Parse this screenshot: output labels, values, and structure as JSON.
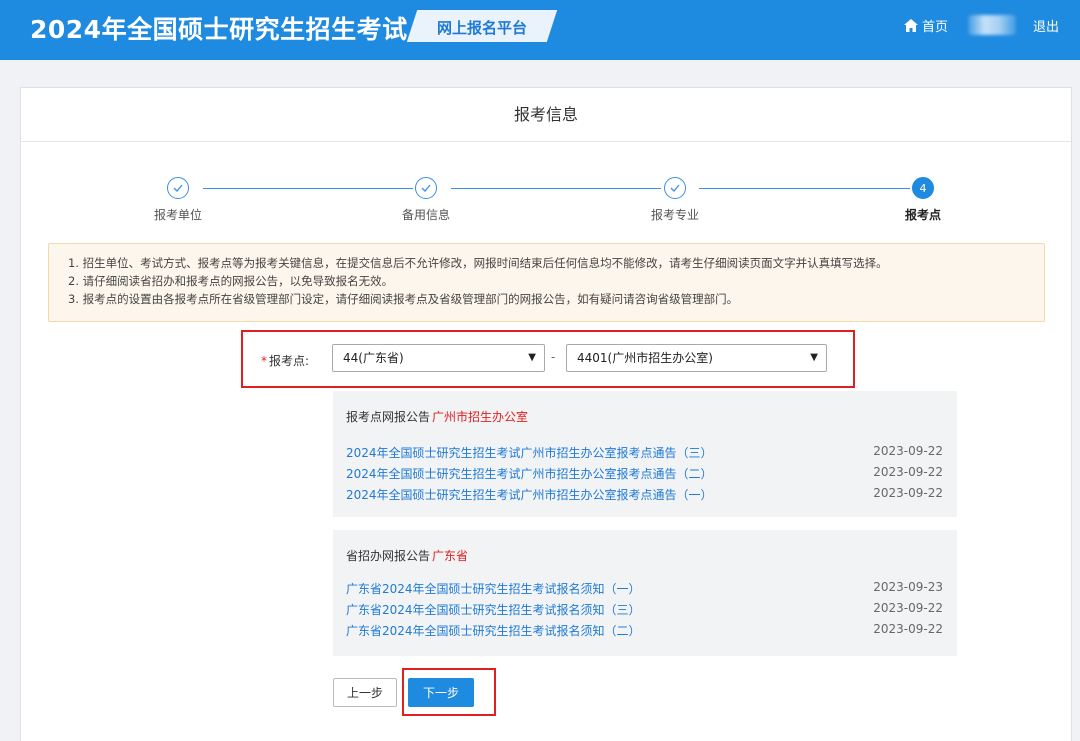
{
  "header": {
    "title": "2024年全国硕士研究生招生考试",
    "platform": "网上报名平台",
    "home": "首页",
    "logout": "退出"
  },
  "panel": {
    "title": "报考信息"
  },
  "steps": [
    {
      "label": "报考单位",
      "status": "done",
      "number": ""
    },
    {
      "label": "备用信息",
      "status": "done",
      "number": ""
    },
    {
      "label": "报考专业",
      "status": "done",
      "number": ""
    },
    {
      "label": "报考点",
      "status": "active",
      "number": "4"
    }
  ],
  "notice": [
    "1. 招生单位、考试方式、报考点等为报考关键信息，在提交信息后不允许修改，网报时间结束后任何信息均不能修改，请考生仔细阅读页面文字并认真填写选择。",
    "2. 请仔细阅读省招办和报考点的网报公告，以免导致报名无效。",
    "3. 报考点的设置由各报考点所在省级管理部门设定，请仔细阅读报考点及省级管理部门的网报公告，如有疑问请咨询省级管理部门。"
  ],
  "form": {
    "required_mark": "*",
    "label": "报考点:",
    "province": "44(广东省)",
    "separator": "-",
    "site": "4401(广州市招生办公室)"
  },
  "site_announcements": {
    "heading": "报考点网报公告",
    "source": "广州市招生办公室",
    "items": [
      {
        "title": "2024年全国硕士研究生招生考试广州市招生办公室报考点通告（三）",
        "date": "2023-09-22"
      },
      {
        "title": "2024年全国硕士研究生招生考试广州市招生办公室报考点通告（二）",
        "date": "2023-09-22"
      },
      {
        "title": "2024年全国硕士研究生招生考试广州市招生办公室报考点通告（一）",
        "date": "2023-09-22"
      }
    ]
  },
  "province_announcements": {
    "heading": "省招办网报公告",
    "source": "广东省",
    "items": [
      {
        "title": "广东省2024年全国硕士研究生招生考试报名须知（一）",
        "date": "2023-09-23"
      },
      {
        "title": "广东省2024年全国硕士研究生招生考试报名须知（三）",
        "date": "2023-09-22"
      },
      {
        "title": "广东省2024年全国硕士研究生招生考试报名须知（二）",
        "date": "2023-09-22"
      }
    ]
  },
  "buttons": {
    "prev": "上一步",
    "next": "下一步"
  },
  "colors": {
    "header_bg": "#1e8ae0",
    "link": "#1e7ad6",
    "highlight": "#e02020",
    "notice_bg": "#fdf6ec"
  }
}
